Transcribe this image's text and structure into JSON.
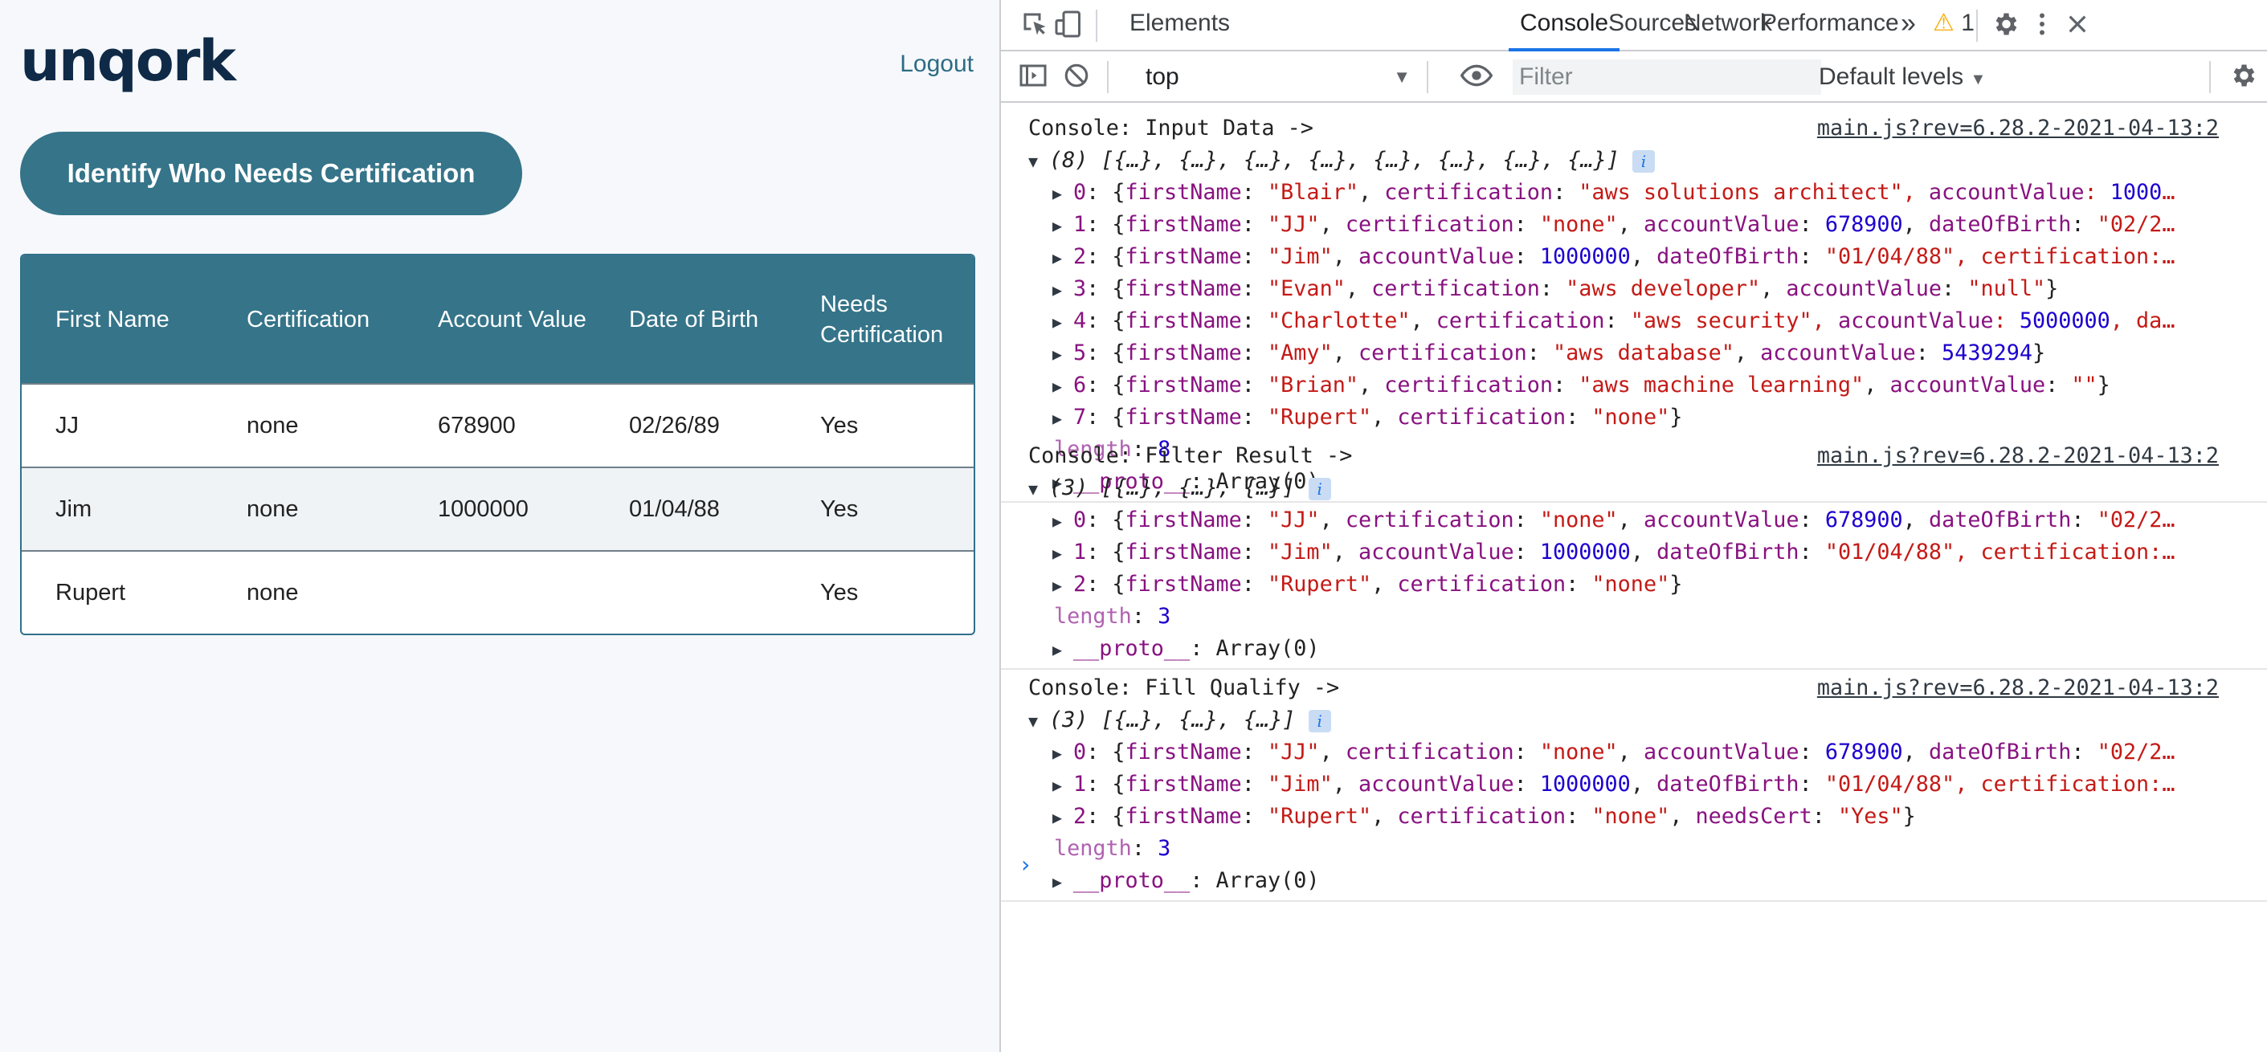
{
  "app": {
    "logo": "unqork",
    "logout_label": "Logout",
    "identify_button_label": "Identify Who Needs Certification",
    "table": {
      "columns": [
        "First Name",
        "Certification",
        "Account Value",
        "Date of Birth",
        "Needs Certification"
      ],
      "rows": [
        [
          "JJ",
          "none",
          "678900",
          "02/26/89",
          "Yes"
        ],
        [
          "Jim",
          "none",
          "1000000",
          "01/04/88",
          "Yes"
        ],
        [
          "Rupert",
          "none",
          "",
          "",
          "Yes"
        ]
      ]
    }
  },
  "devtools": {
    "tabs": [
      "Elements",
      "Console",
      "Sources",
      "Network",
      "Performance"
    ],
    "active_tab": "Console",
    "more_tabs": "»",
    "warning_count": "1",
    "context": "top",
    "filter_placeholder": "Filter",
    "levels_label": "Default levels",
    "accent_color": "#1a73e8",
    "messages": [
      {
        "label": "Console: Input Data ->",
        "source": "main.js?rev=6.28.2-2021-04-13:2",
        "summary": "(8) [{…}, {…}, {…}, {…}, {…}, {…}, {…}, {…}]",
        "items": [
          "0: {firstName: \"Blair\", certification: \"aws solutions architect\", accountValue: 1000…",
          "1: {firstName: \"JJ\", certification: \"none\", accountValue: 678900, dateOfBirth: \"02/2…",
          "2: {firstName: \"Jim\", accountValue: 1000000, dateOfBirth: \"01/04/88\", certification:…",
          "3: {firstName: \"Evan\", certification: \"aws developer\", accountValue: \"null\"}",
          "4: {firstName: \"Charlotte\", certification: \"aws security\", accountValue: 5000000, da…",
          "5: {firstName: \"Amy\", certification: \"aws database\", accountValue: 5439294}",
          "6: {firstName: \"Brian\", certification: \"aws machine learning\", accountValue: \"\"}",
          "7: {firstName: \"Rupert\", certification: \"none\"}"
        ],
        "length": "length: 8",
        "proto": "__proto__: Array(0)"
      },
      {
        "label": "Console: Filter Result ->",
        "source": "main.js?rev=6.28.2-2021-04-13:2",
        "summary": "(3) [{…}, {…}, {…}]",
        "items": [
          "0: {firstName: \"JJ\", certification: \"none\", accountValue: 678900, dateOfBirth: \"02/2…",
          "1: {firstName: \"Jim\", accountValue: 1000000, dateOfBirth: \"01/04/88\", certification:…",
          "2: {firstName: \"Rupert\", certification: \"none\"}"
        ],
        "length": "length: 3",
        "proto": "__proto__: Array(0)"
      },
      {
        "label": "Console: Fill Qualify ->",
        "source": "main.js?rev=6.28.2-2021-04-13:2",
        "summary": "(3) [{…}, {…}, {…}]",
        "items": [
          "0: {firstName: \"JJ\", certification: \"none\", accountValue: 678900, dateOfBirth: \"02/2…",
          "1: {firstName: \"Jim\", accountValue: 1000000, dateOfBirth: \"01/04/88\", certification:…",
          "2: {firstName: \"Rupert\", certification: \"none\", needsCert: \"Yes\"}"
        ],
        "length": "length: 3",
        "proto": "__proto__: Array(0)"
      }
    ],
    "prompt_symbol": "›"
  }
}
